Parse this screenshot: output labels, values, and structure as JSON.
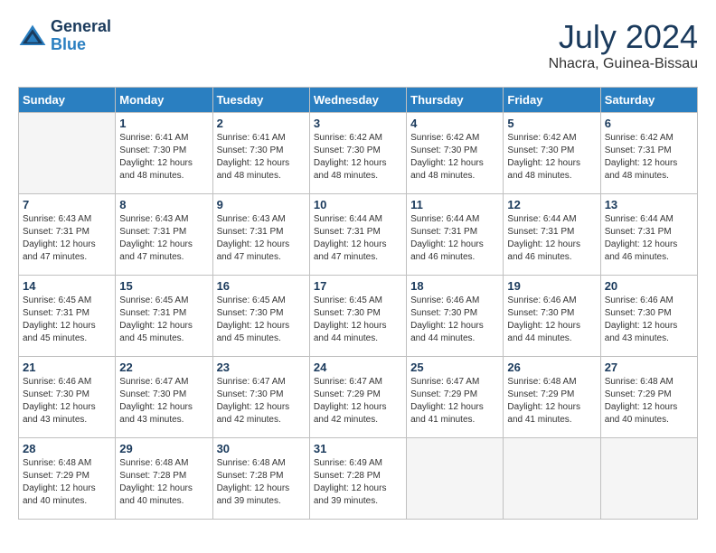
{
  "header": {
    "logo_line1": "General",
    "logo_line2": "Blue",
    "main_title": "July 2024",
    "subtitle": "Nhacra, Guinea-Bissau"
  },
  "calendar": {
    "days_of_week": [
      "Sunday",
      "Monday",
      "Tuesday",
      "Wednesday",
      "Thursday",
      "Friday",
      "Saturday"
    ],
    "weeks": [
      [
        {
          "day": "",
          "sunrise": "",
          "sunset": "",
          "daylight": ""
        },
        {
          "day": "1",
          "sunrise": "6:41 AM",
          "sunset": "7:30 PM",
          "daylight": "12 hours and 48 minutes."
        },
        {
          "day": "2",
          "sunrise": "6:41 AM",
          "sunset": "7:30 PM",
          "daylight": "12 hours and 48 minutes."
        },
        {
          "day": "3",
          "sunrise": "6:42 AM",
          "sunset": "7:30 PM",
          "daylight": "12 hours and 48 minutes."
        },
        {
          "day": "4",
          "sunrise": "6:42 AM",
          "sunset": "7:30 PM",
          "daylight": "12 hours and 48 minutes."
        },
        {
          "day": "5",
          "sunrise": "6:42 AM",
          "sunset": "7:30 PM",
          "daylight": "12 hours and 48 minutes."
        },
        {
          "day": "6",
          "sunrise": "6:42 AM",
          "sunset": "7:31 PM",
          "daylight": "12 hours and 48 minutes."
        }
      ],
      [
        {
          "day": "7",
          "sunrise": "6:43 AM",
          "sunset": "7:31 PM",
          "daylight": "12 hours and 47 minutes."
        },
        {
          "day": "8",
          "sunrise": "6:43 AM",
          "sunset": "7:31 PM",
          "daylight": "12 hours and 47 minutes."
        },
        {
          "day": "9",
          "sunrise": "6:43 AM",
          "sunset": "7:31 PM",
          "daylight": "12 hours and 47 minutes."
        },
        {
          "day": "10",
          "sunrise": "6:44 AM",
          "sunset": "7:31 PM",
          "daylight": "12 hours and 47 minutes."
        },
        {
          "day": "11",
          "sunrise": "6:44 AM",
          "sunset": "7:31 PM",
          "daylight": "12 hours and 46 minutes."
        },
        {
          "day": "12",
          "sunrise": "6:44 AM",
          "sunset": "7:31 PM",
          "daylight": "12 hours and 46 minutes."
        },
        {
          "day": "13",
          "sunrise": "6:44 AM",
          "sunset": "7:31 PM",
          "daylight": "12 hours and 46 minutes."
        }
      ],
      [
        {
          "day": "14",
          "sunrise": "6:45 AM",
          "sunset": "7:31 PM",
          "daylight": "12 hours and 45 minutes."
        },
        {
          "day": "15",
          "sunrise": "6:45 AM",
          "sunset": "7:31 PM",
          "daylight": "12 hours and 45 minutes."
        },
        {
          "day": "16",
          "sunrise": "6:45 AM",
          "sunset": "7:30 PM",
          "daylight": "12 hours and 45 minutes."
        },
        {
          "day": "17",
          "sunrise": "6:45 AM",
          "sunset": "7:30 PM",
          "daylight": "12 hours and 44 minutes."
        },
        {
          "day": "18",
          "sunrise": "6:46 AM",
          "sunset": "7:30 PM",
          "daylight": "12 hours and 44 minutes."
        },
        {
          "day": "19",
          "sunrise": "6:46 AM",
          "sunset": "7:30 PM",
          "daylight": "12 hours and 44 minutes."
        },
        {
          "day": "20",
          "sunrise": "6:46 AM",
          "sunset": "7:30 PM",
          "daylight": "12 hours and 43 minutes."
        }
      ],
      [
        {
          "day": "21",
          "sunrise": "6:46 AM",
          "sunset": "7:30 PM",
          "daylight": "12 hours and 43 minutes."
        },
        {
          "day": "22",
          "sunrise": "6:47 AM",
          "sunset": "7:30 PM",
          "daylight": "12 hours and 43 minutes."
        },
        {
          "day": "23",
          "sunrise": "6:47 AM",
          "sunset": "7:30 PM",
          "daylight": "12 hours and 42 minutes."
        },
        {
          "day": "24",
          "sunrise": "6:47 AM",
          "sunset": "7:29 PM",
          "daylight": "12 hours and 42 minutes."
        },
        {
          "day": "25",
          "sunrise": "6:47 AM",
          "sunset": "7:29 PM",
          "daylight": "12 hours and 41 minutes."
        },
        {
          "day": "26",
          "sunrise": "6:48 AM",
          "sunset": "7:29 PM",
          "daylight": "12 hours and 41 minutes."
        },
        {
          "day": "27",
          "sunrise": "6:48 AM",
          "sunset": "7:29 PM",
          "daylight": "12 hours and 40 minutes."
        }
      ],
      [
        {
          "day": "28",
          "sunrise": "6:48 AM",
          "sunset": "7:29 PM",
          "daylight": "12 hours and 40 minutes."
        },
        {
          "day": "29",
          "sunrise": "6:48 AM",
          "sunset": "7:28 PM",
          "daylight": "12 hours and 40 minutes."
        },
        {
          "day": "30",
          "sunrise": "6:48 AM",
          "sunset": "7:28 PM",
          "daylight": "12 hours and 39 minutes."
        },
        {
          "day": "31",
          "sunrise": "6:49 AM",
          "sunset": "7:28 PM",
          "daylight": "12 hours and 39 minutes."
        },
        {
          "day": "",
          "sunrise": "",
          "sunset": "",
          "daylight": ""
        },
        {
          "day": "",
          "sunrise": "",
          "sunset": "",
          "daylight": ""
        },
        {
          "day": "",
          "sunrise": "",
          "sunset": "",
          "daylight": ""
        }
      ]
    ]
  }
}
